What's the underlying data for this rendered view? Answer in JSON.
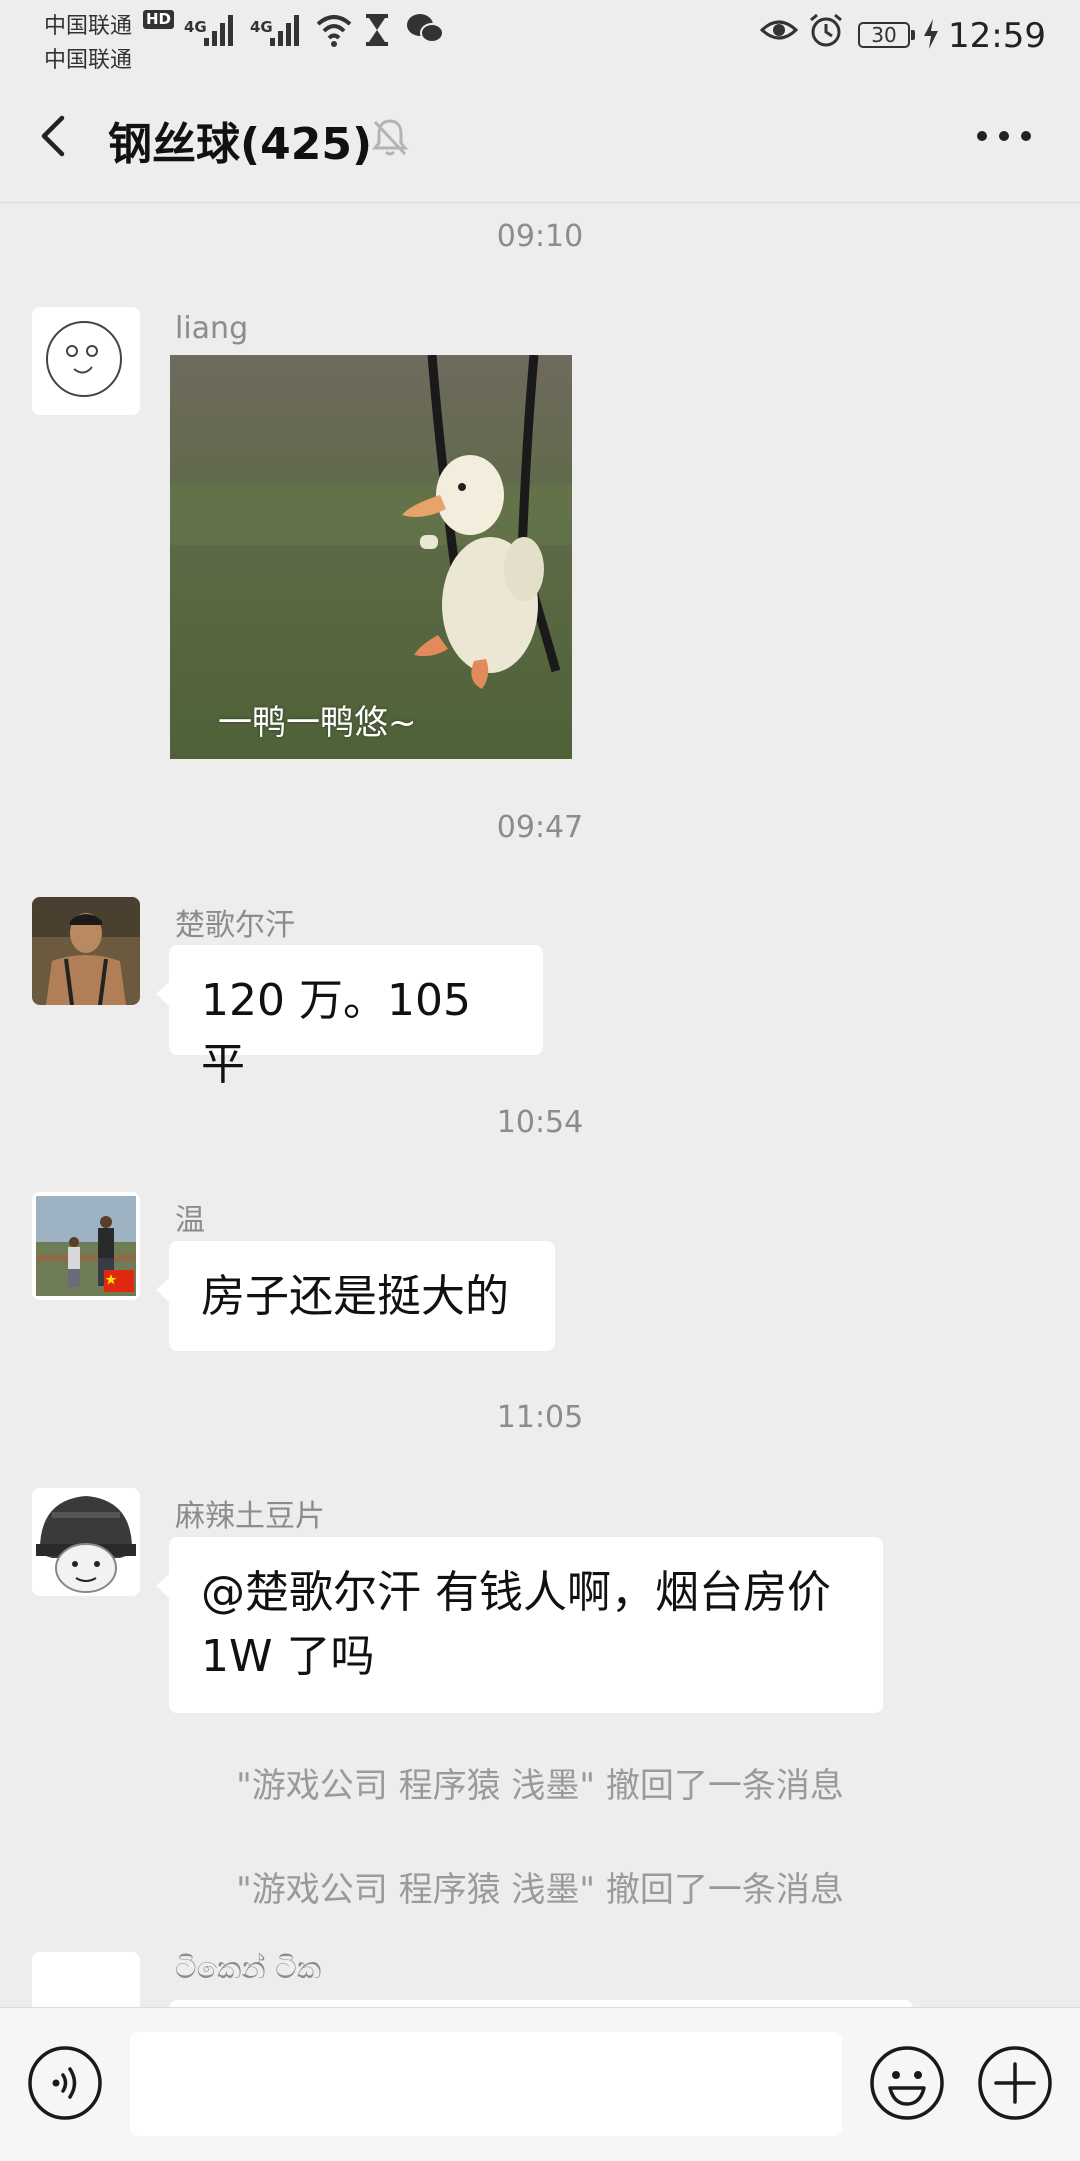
{
  "status_bar": {
    "carrier_1": "中国联通",
    "carrier_2": "中国联通",
    "hd_badge": "HD",
    "network_1": "4G",
    "network_2": "4G",
    "battery_level": "30",
    "time": "12:59",
    "icons": [
      "signal-icon",
      "wifi-icon",
      "hourglass-icon",
      "wechat-icon",
      "eye-icon",
      "alarm-icon",
      "battery-icon",
      "charging-icon"
    ]
  },
  "nav": {
    "back_icon": "chevron-left-icon",
    "title": "钢丝球(425)",
    "mute_icon": "bell-off-icon",
    "more_icon": "more-icon"
  },
  "messages": {
    "ts_1": "09:10",
    "m1_sender": "liang",
    "m1_image_caption": "一鸭一鸭悠~",
    "ts_2": "09:47",
    "m2_sender": "楚歌尔汗",
    "m2_text": "120 万。105 平",
    "ts_3": "10:54",
    "m3_sender": "温",
    "m3_text": "房子还是挺大的",
    "ts_4": "11:05",
    "m4_sender": "麻辣土豆片",
    "m4_text_line1": "@楚歌尔汗 有钱人啊，烟台房价",
    "m4_text_line2": "1W 了吗",
    "recall_1": "\"游戏公司 程序猿 浅墨\" 撤回了一条消息",
    "recall_2": "\"游戏公司 程序猿 浅墨\" 撤回了一条消息",
    "m5_sender": "ටිකෙන් ටික"
  },
  "input_bar": {
    "voice_icon": "voice-icon",
    "input_value": "",
    "emoji_icon": "emoji-icon",
    "plus_icon": "plus-icon"
  },
  "colors": {
    "background": "#ededed",
    "bubble": "#ffffff",
    "timestamp_text": "#8c8c8c",
    "input_bar": "#f6f6f6"
  }
}
